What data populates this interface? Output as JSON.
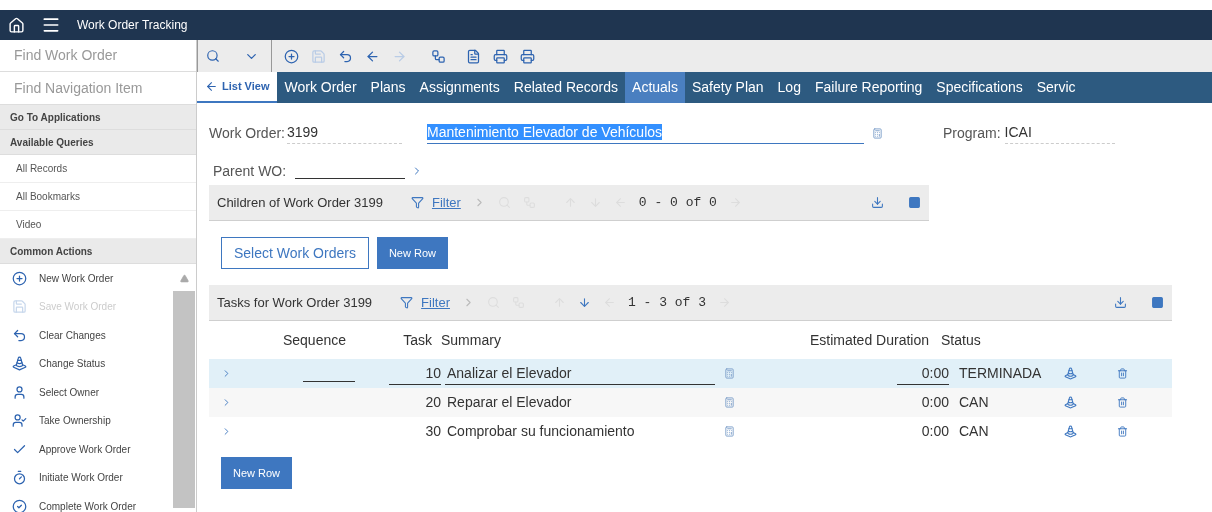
{
  "header": {
    "title": "Work Order Tracking"
  },
  "sidebar": {
    "find_work_order": {
      "placeholder": "Find Work Order"
    },
    "find_navigation": {
      "placeholder": "Find Navigation Item"
    },
    "sections": [
      {
        "title": "Go To Applications"
      },
      {
        "title": "Available Queries",
        "items": [
          {
            "label": "All Records"
          },
          {
            "label": "All Bookmarks"
          },
          {
            "label": "Video"
          }
        ]
      },
      {
        "title": "Common Actions"
      }
    ],
    "actions": [
      {
        "label": "New Work Order",
        "disabled": false
      },
      {
        "label": "Save Work Order",
        "disabled": true
      },
      {
        "label": "Clear Changes",
        "disabled": false
      },
      {
        "label": "Change Status",
        "disabled": false
      },
      {
        "label": "Select Owner",
        "disabled": false
      },
      {
        "label": "Take Ownership",
        "disabled": false
      },
      {
        "label": "Approve Work Order",
        "disabled": false
      },
      {
        "label": "Initiate Work Order",
        "disabled": false
      },
      {
        "label": "Complete Work Order",
        "disabled": false
      }
    ]
  },
  "tabs": [
    {
      "label": "List View",
      "kind": "back",
      "selected": false
    },
    {
      "label": "Work Order",
      "kind": "tab",
      "selected": false
    },
    {
      "label": "Plans",
      "kind": "tab",
      "selected": false
    },
    {
      "label": "Assignments",
      "kind": "tab",
      "selected": false
    },
    {
      "label": "Related Records",
      "kind": "tab",
      "selected": false
    },
    {
      "label": "Actuals",
      "kind": "tab",
      "selected": true
    },
    {
      "label": "Safety Plan",
      "kind": "tab",
      "selected": false
    },
    {
      "label": "Log",
      "kind": "tab",
      "selected": false
    },
    {
      "label": "Failure Reporting",
      "kind": "tab",
      "selected": false
    },
    {
      "label": "Specifications",
      "kind": "tab",
      "selected": false
    },
    {
      "label": "Servic",
      "kind": "tab",
      "selected": false
    }
  ],
  "form": {
    "work_order": {
      "label": "Work Order:",
      "value": "3199"
    },
    "description": {
      "value": "Mantenimiento Elevador de Vehículos",
      "highlighted": true
    },
    "program": {
      "label": "Program:",
      "value": "ICAI"
    },
    "parent_wo": {
      "label": "Parent WO:"
    }
  },
  "children": {
    "title": "Children of Work Order 3199",
    "filter": "Filter",
    "pager": "0 - 0 of 0",
    "down_enabled": false,
    "buttons": [
      {
        "label": "Select Work Orders",
        "kind": "outline"
      },
      {
        "label": "New Row",
        "kind": "primary"
      }
    ]
  },
  "tasks": {
    "title": "Tasks for Work Order 3199",
    "filter": "Filter",
    "pager": "1 - 3 of 3",
    "down_enabled": true,
    "columns": [
      "Sequence",
      "Task",
      "Summary",
      "Estimated Duration",
      "Status"
    ],
    "rows": [
      {
        "task": "10",
        "summary": "Analizar el Elevador",
        "duration": "0:00",
        "status": "TERMINADA",
        "selected": true
      },
      {
        "task": "20",
        "summary": "Reparar el Elevador",
        "duration": "0:00",
        "status": "CAN",
        "selected": false
      },
      {
        "task": "30",
        "summary": "Comprobar su funcionamiento",
        "duration": "0:00",
        "status": "CAN",
        "selected": false
      }
    ],
    "buttons": [
      {
        "label": "New Row",
        "kind": "primary"
      }
    ]
  }
}
